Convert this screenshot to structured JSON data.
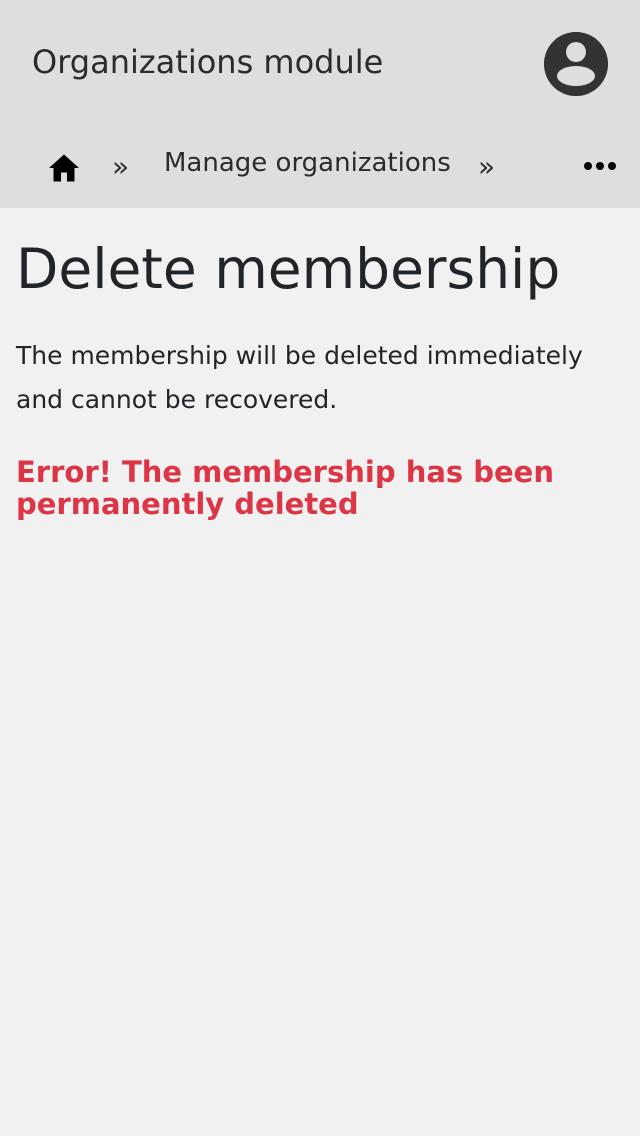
{
  "header": {
    "app_title": "Organizations module"
  },
  "breadcrumb": {
    "separator": "»",
    "items": [
      {
        "label": "Manage organizations"
      }
    ]
  },
  "main": {
    "title": "Delete membership",
    "description": "The membership will be deleted immediately and cannot be recovered.",
    "error": "Error! The membership has been permanently deleted"
  },
  "icons": {
    "avatar": "user-circle-icon",
    "home": "home-icon",
    "more": "more-horizontal-icon"
  },
  "colors": {
    "header_bg": "#dedede",
    "page_bg": "#f1f1f1",
    "error": "#dc3545",
    "text": "#212529",
    "avatar": "#333333"
  }
}
